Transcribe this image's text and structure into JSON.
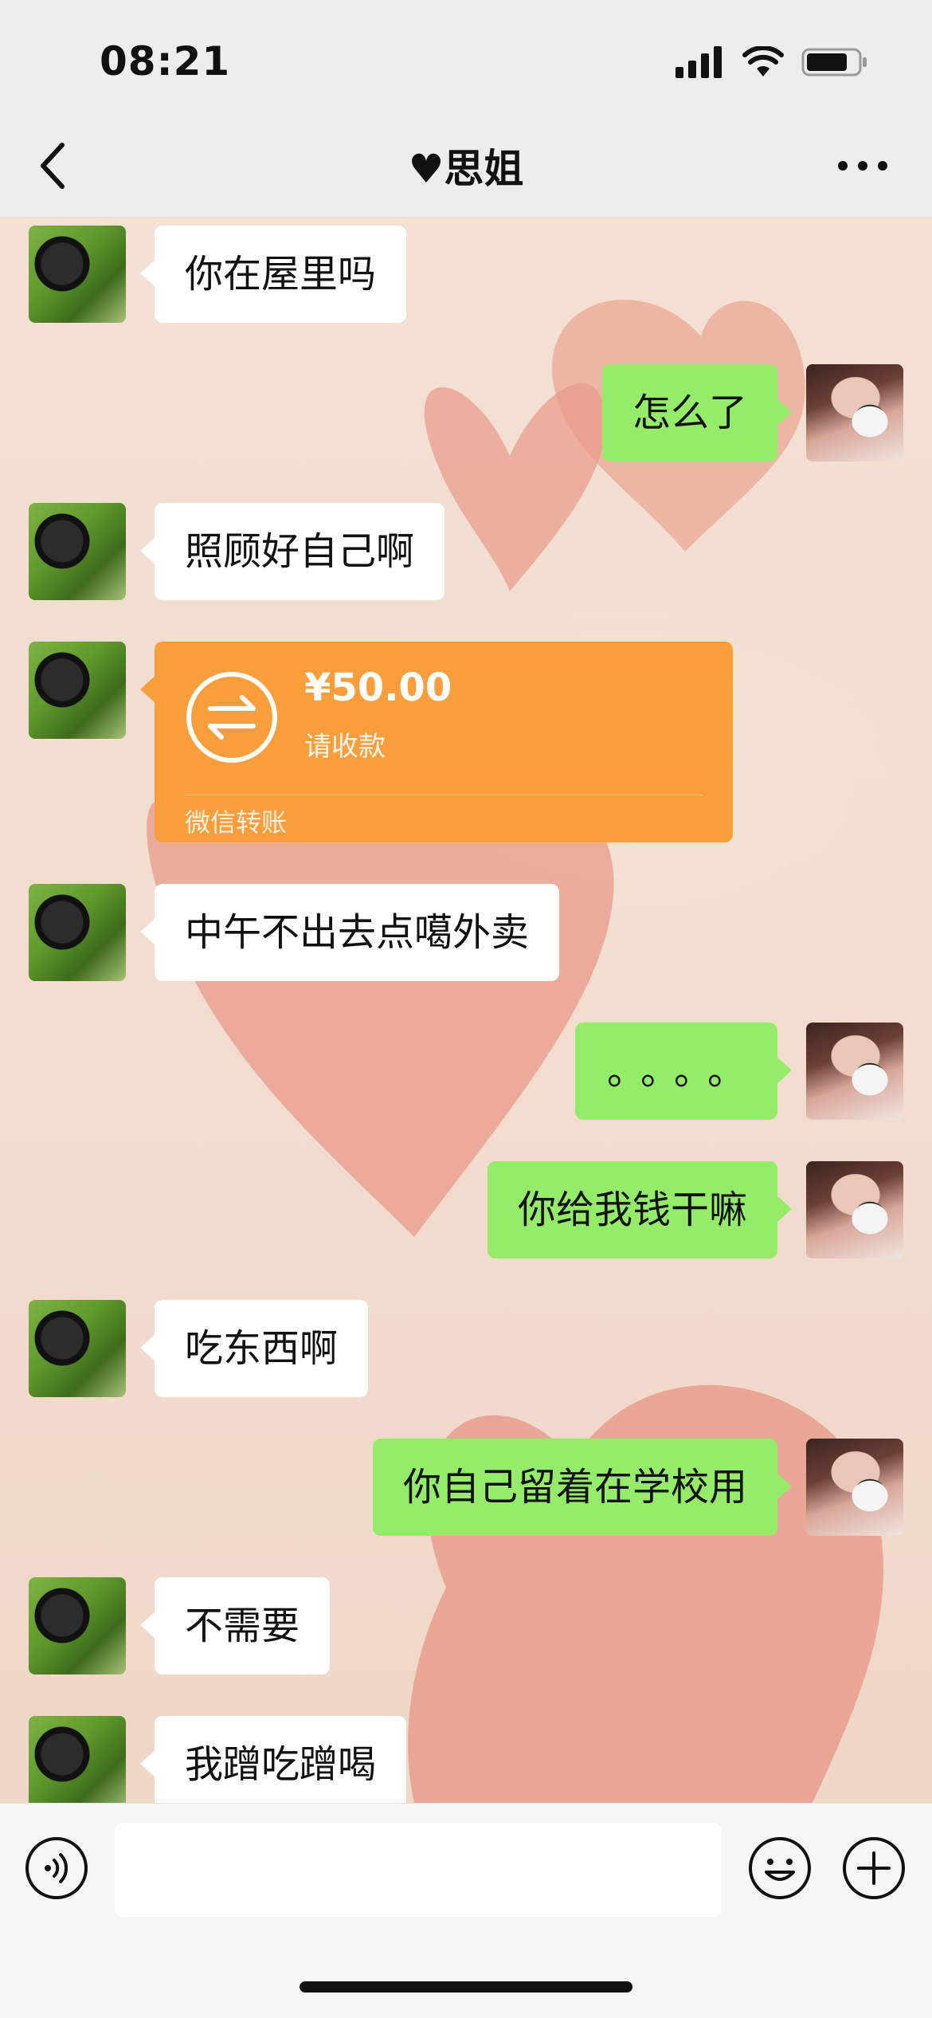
{
  "status_bar": {
    "time": "08:21",
    "battery_level": 0.8
  },
  "nav": {
    "title": "♥思姐",
    "back_icon": "chevron-left-icon",
    "more_icon": "ellipsis-icon"
  },
  "messages": [
    {
      "side": "left",
      "type": "text",
      "text": "你在屋里吗"
    },
    {
      "side": "right",
      "type": "text",
      "text": "怎么了"
    },
    {
      "side": "left",
      "type": "text",
      "text": "照顾好自己啊"
    },
    {
      "side": "left",
      "type": "transfer",
      "amount": "¥50.00",
      "status": "请收款",
      "footer": "微信转账"
    },
    {
      "side": "left",
      "type": "text",
      "text": "中午不出去点噶外卖"
    },
    {
      "side": "right",
      "type": "text",
      "text": "。。。。"
    },
    {
      "side": "right",
      "type": "text",
      "text": "你给我钱干嘛"
    },
    {
      "side": "left",
      "type": "text",
      "text": "吃东西啊"
    },
    {
      "side": "right",
      "type": "text",
      "text": "你自己留着在学校用"
    },
    {
      "side": "left",
      "type": "text",
      "text": "不需要"
    },
    {
      "side": "left",
      "type": "text",
      "text": "我蹭吃蹭喝"
    }
  ],
  "input_bar": {
    "voice_icon": "voice-icon",
    "input_value": "",
    "emoji_icon": "emoji-icon",
    "plus_icon": "plus-icon"
  },
  "colors": {
    "received_bubble": "#ffffff",
    "sent_bubble": "#95ec69",
    "transfer_card": "#fa9d3b",
    "wallpaper_heart": "#e9a08c"
  }
}
